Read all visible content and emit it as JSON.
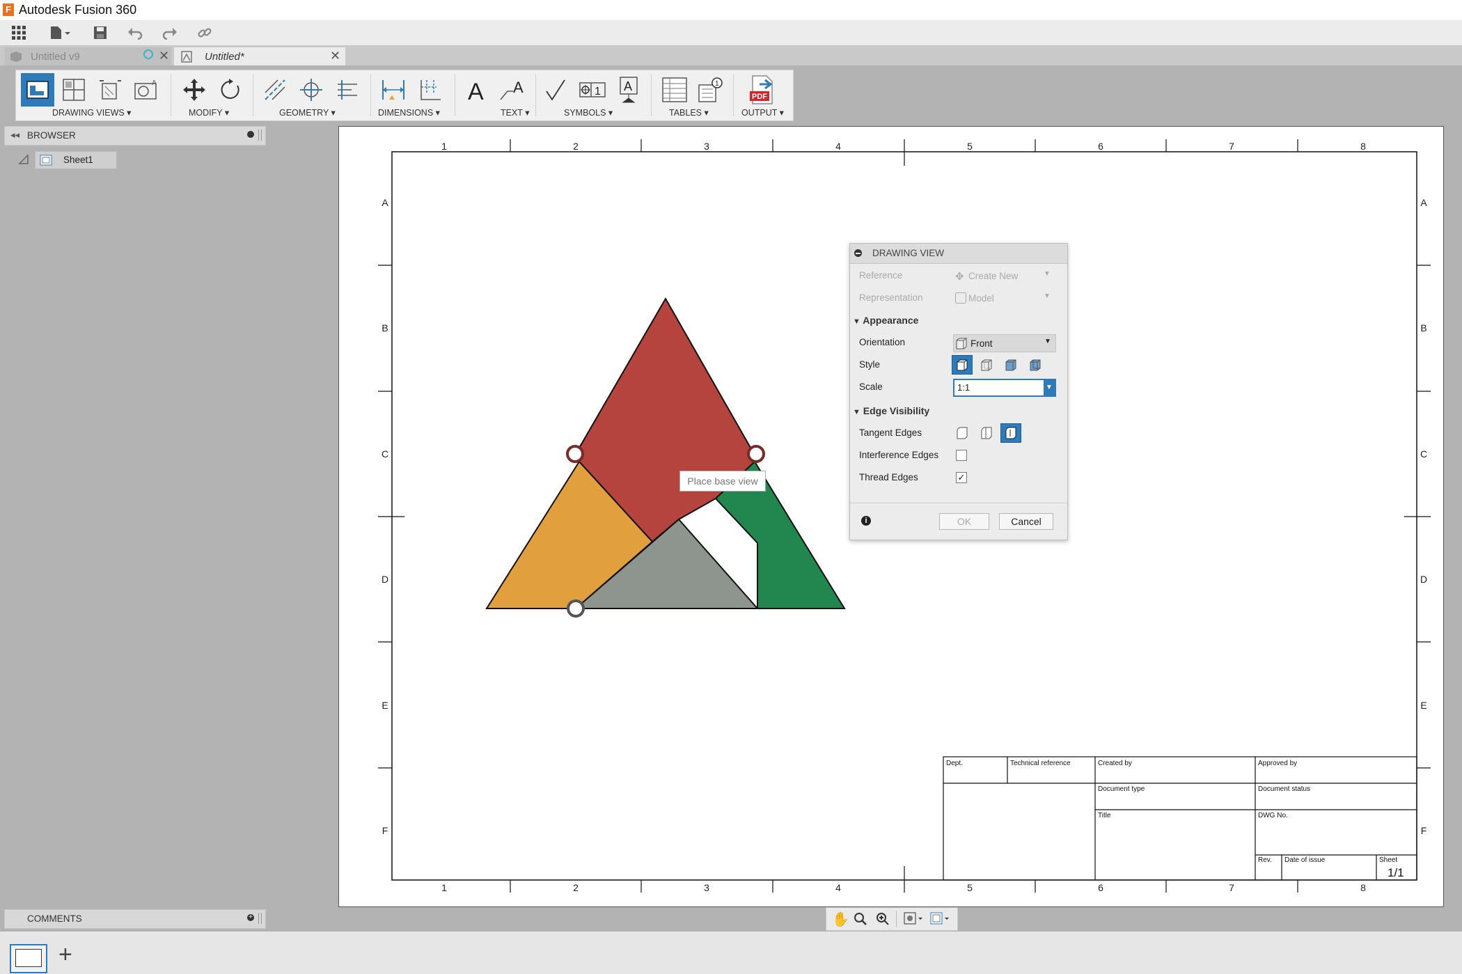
{
  "window": {
    "title": "Autodesk Fusion 360"
  },
  "doc_tabs": [
    {
      "label": "Untitled v9",
      "active": false
    },
    {
      "label": "Untitled*",
      "active": true
    }
  ],
  "toolbar": {
    "groups": [
      {
        "label": "DRAWING VIEWS ▾"
      },
      {
        "label": "MODIFY ▾"
      },
      {
        "label": "GEOMETRY ▾"
      },
      {
        "label": "DIMENSIONS ▾"
      },
      {
        "label": "TEXT ▾"
      },
      {
        "label": "SYMBOLS ▾"
      },
      {
        "label": "TABLES ▾"
      },
      {
        "label": "OUTPUT ▾"
      }
    ],
    "pdf_label": "PDF"
  },
  "browser": {
    "title": "BROWSER",
    "items": [
      {
        "label": "Sheet1"
      }
    ]
  },
  "comments": {
    "title": "COMMENTS"
  },
  "sheet": {
    "col_labels": [
      "1",
      "2",
      "3",
      "4",
      "5",
      "6",
      "7",
      "8"
    ],
    "row_labels": [
      "A",
      "B",
      "C",
      "D",
      "E",
      "F"
    ]
  },
  "title_block": {
    "dept": "Dept.",
    "technical_reference": "Technical reference",
    "created_by": "Created by",
    "approved_by": "Approved by",
    "document_type": "Document type",
    "document_status": "Document status",
    "title": "Title",
    "dwg_no": "DWG No.",
    "rev": "Rev.",
    "date_of_issue": "Date of issue",
    "sheet_label": "Sheet",
    "sheet_value": "1/1"
  },
  "tooltip": "Place base view",
  "dialog": {
    "title": "DRAWING VIEW",
    "reference": {
      "label": "Reference",
      "value": "Create New"
    },
    "representation": {
      "label": "Representation",
      "value": "Model"
    },
    "appearance_section": "Appearance",
    "orientation": {
      "label": "Orientation",
      "value": "Front"
    },
    "style": {
      "label": "Style",
      "selected_index": 0
    },
    "scale": {
      "label": "Scale",
      "value": "1:1"
    },
    "edge_visibility_section": "Edge Visibility",
    "tangent_edges": {
      "label": "Tangent Edges",
      "selected_index": 2
    },
    "interference_edges": {
      "label": "Interference Edges",
      "checked": false
    },
    "thread_edges": {
      "label": "Thread Edges",
      "checked": true
    },
    "ok_label": "OK",
    "cancel_label": "Cancel"
  },
  "model_colors": {
    "top": "#b5433e",
    "left": "#e19f3d",
    "right": "#22874e",
    "center": "#8e958e"
  }
}
